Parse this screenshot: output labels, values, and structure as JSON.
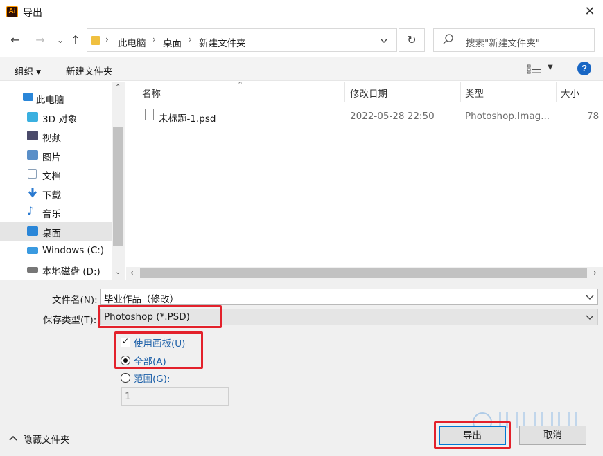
{
  "window": {
    "app_icon_text": "Ai",
    "title": "导出",
    "close_glyph": "✕"
  },
  "nav": {
    "back_glyph": "←",
    "forward_glyph": "→",
    "recent_glyph": "⌄",
    "up_glyph": "↑",
    "breadcrumb": [
      "此电脑",
      "桌面",
      "新建文件夹"
    ],
    "breadcrumb_sep": "›",
    "refresh_glyph": "↻",
    "search_placeholder": "搜索\"新建文件夹\""
  },
  "toolbar": {
    "organize": "组织 ▾",
    "new_folder": "新建文件夹",
    "help": "?"
  },
  "sidebar": {
    "items": [
      {
        "label": "此电脑",
        "icon": "computer-icon",
        "color": "#2a86d8"
      },
      {
        "label": "3D 对象",
        "icon": "cube-icon",
        "color": "#3ab0e0"
      },
      {
        "label": "视频",
        "icon": "video-icon",
        "color": "#4a4a6a"
      },
      {
        "label": "图片",
        "icon": "pictures-icon",
        "color": "#5a8fc8"
      },
      {
        "label": "文档",
        "icon": "document-icon",
        "color": "#8aa0b8"
      },
      {
        "label": "下载",
        "icon": "download-icon",
        "color": "#2a7ad0"
      },
      {
        "label": "音乐",
        "icon": "music-icon",
        "color": "#2a7ad0"
      },
      {
        "label": "桌面",
        "icon": "desktop-icon",
        "color": "#2a86d8"
      },
      {
        "label": "Windows (C:)",
        "icon": "windows-drive-icon",
        "color": "#3a9ae0"
      },
      {
        "label": "本地磁盘 (D:)",
        "icon": "disk-drive-icon",
        "color": "#777777"
      }
    ],
    "selected_index": 7
  },
  "filelist": {
    "columns": [
      "名称",
      "修改日期",
      "类型",
      "大小"
    ],
    "rows": [
      {
        "name": "未标题-1.psd",
        "modified": "2022-05-28 22:50",
        "type": "Photoshop.Imag...",
        "size": "78"
      }
    ]
  },
  "form": {
    "filename_label": "文件名(N):",
    "filename_value": "毕业作品（修改）",
    "type_label": "保存类型(T):",
    "type_value": "Photoshop (*.PSD)",
    "use_artboards_label": "使用画板(U)",
    "use_artboards_checked": true,
    "all_label": "全部(A)",
    "range_label": "范围(G):",
    "range_value": "1",
    "hide_folders": "隐藏文件夹",
    "export_button": "导出",
    "cancel_button": "取消"
  },
  "colors": {
    "accent": "#0078d4",
    "highlight_red": "#e3212b",
    "option_blue": "#1b5fa8"
  }
}
